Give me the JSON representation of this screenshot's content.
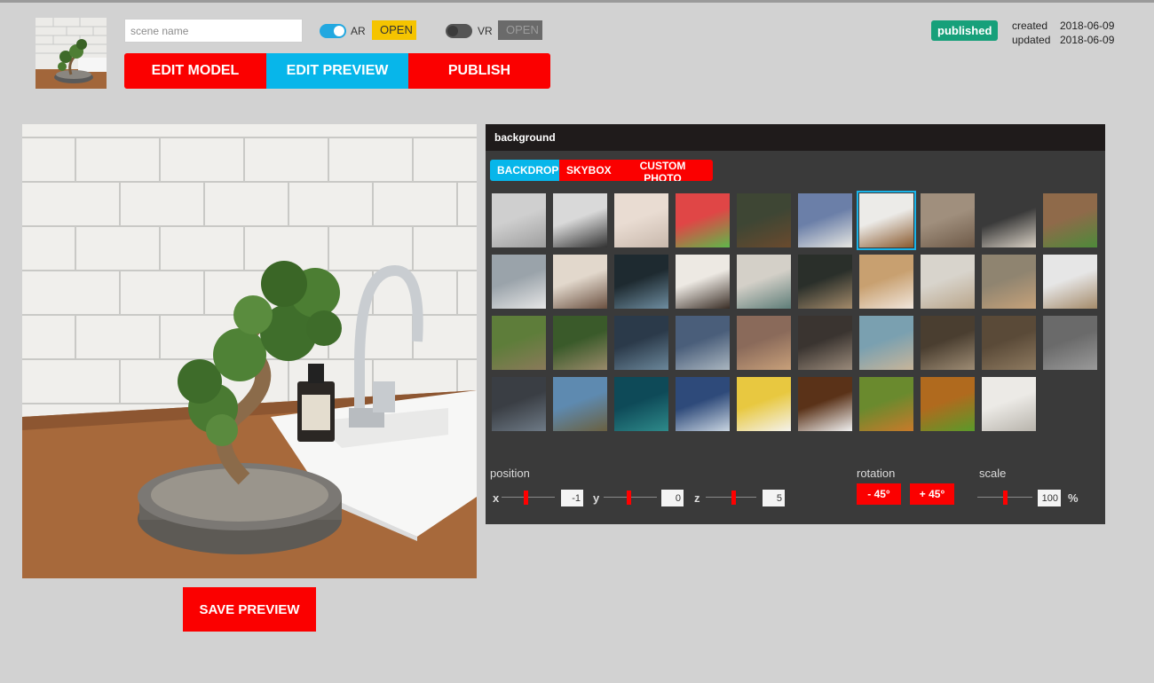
{
  "header": {
    "scene_name_placeholder": "scene name",
    "scene_name_value": "",
    "ar": {
      "label": "AR",
      "enabled": true,
      "open_label": "OPEN"
    },
    "vr": {
      "label": "VR",
      "enabled": false,
      "open_label": "OPEN"
    },
    "tabs": [
      {
        "label": "EDIT MODEL",
        "active": false
      },
      {
        "label": "EDIT PREVIEW",
        "active": true
      },
      {
        "label": "PUBLISH",
        "active": false
      }
    ],
    "status_badge": "published",
    "created_label": "created",
    "created_value": "2018-06-09",
    "updated_label": "updated",
    "updated_value": "2018-06-09"
  },
  "preview": {
    "save_label": "SAVE PREVIEW"
  },
  "background_panel": {
    "title": "background",
    "tabs": [
      {
        "label": "BACKDROP",
        "active": true
      },
      {
        "label": "SKYBOX",
        "active": false
      },
      {
        "label": "CUSTOM PHOTO",
        "active": false
      }
    ],
    "selected_index": 6,
    "tiles": [
      [
        "#cfcfcf",
        "#9e9e9e"
      ],
      [
        "#d9d9d9",
        "#333333"
      ],
      [
        "#e9dcd2",
        "#c8b8ac"
      ],
      [
        "#e04646",
        "#5fb84a"
      ],
      [
        "#3e4634",
        "#6a4a2e"
      ],
      [
        "#6b7fa8",
        "#e7e7e2"
      ],
      [
        "#ecebe8",
        "#8a5a2e"
      ],
      [
        "#a08f7d",
        "#6e5a48"
      ],
      [
        "#3a3a3a",
        "#d8d0c4"
      ],
      [
        "#8f6a4a",
        "#4d8a3a"
      ],
      [
        "#9aa3aa",
        "#e6e6e6"
      ],
      [
        "#e2d8cc",
        "#6a5040"
      ],
      [
        "#1e2a30",
        "#6e8da0"
      ],
      [
        "#ede9e3",
        "#3a2e26"
      ],
      [
        "#d4d0c8",
        "#5e7d78"
      ],
      [
        "#2a2f2a",
        "#a38a6a"
      ],
      [
        "#c8a070",
        "#f0e6dc"
      ],
      [
        "#d8d4cc",
        "#b9a58a"
      ],
      [
        "#8f8470",
        "#c6a27a"
      ],
      [
        "#e6e6e6",
        "#a48a6a"
      ],
      [
        "#5e7d3a",
        "#8a7a5a"
      ],
      [
        "#3a5a2a",
        "#9a8a6a"
      ],
      [
        "#2b3a4a",
        "#6b879a"
      ],
      [
        "#4a5e7a",
        "#aab6c0"
      ],
      [
        "#8a6a5a",
        "#c8a07a"
      ],
      [
        "#3a3430",
        "#9a8a7a"
      ],
      [
        "#7aa0b0",
        "#c8b59a"
      ],
      [
        "#4a3e30",
        "#9e8c74"
      ],
      [
        "#5a4a38",
        "#8e7a60"
      ],
      [
        "#6a6a6a",
        "#9a9a9a"
      ],
      [
        "#3a3e44",
        "#6e7a86"
      ],
      [
        "#5e8ab0",
        "#6a6040"
      ],
      [
        "#0e4a58",
        "#2e8a8a"
      ],
      [
        "#2e4a7a",
        "#c8d4e0"
      ],
      [
        "#e8c840",
        "#f4f2ec"
      ],
      [
        "#5a3218",
        "#f0f0f0"
      ],
      [
        "#6a8a2e",
        "#c87a2a"
      ],
      [
        "#b06a1e",
        "#5a9a2a"
      ],
      [
        "#eceae6",
        "#b8b4ac"
      ]
    ],
    "position": {
      "label": "position",
      "x": {
        "label": "x",
        "value": "-1",
        "level": 0.45
      },
      "y": {
        "label": "y",
        "value": "0",
        "level": 0.48
      },
      "z": {
        "label": "z",
        "value": "5",
        "level": 0.55
      }
    },
    "rotation": {
      "label": "rotation",
      "minus": "- 45°",
      "plus": "+ 45°"
    },
    "scale": {
      "label": "scale",
      "value": "100",
      "unit": "%",
      "level": 0.5
    }
  }
}
